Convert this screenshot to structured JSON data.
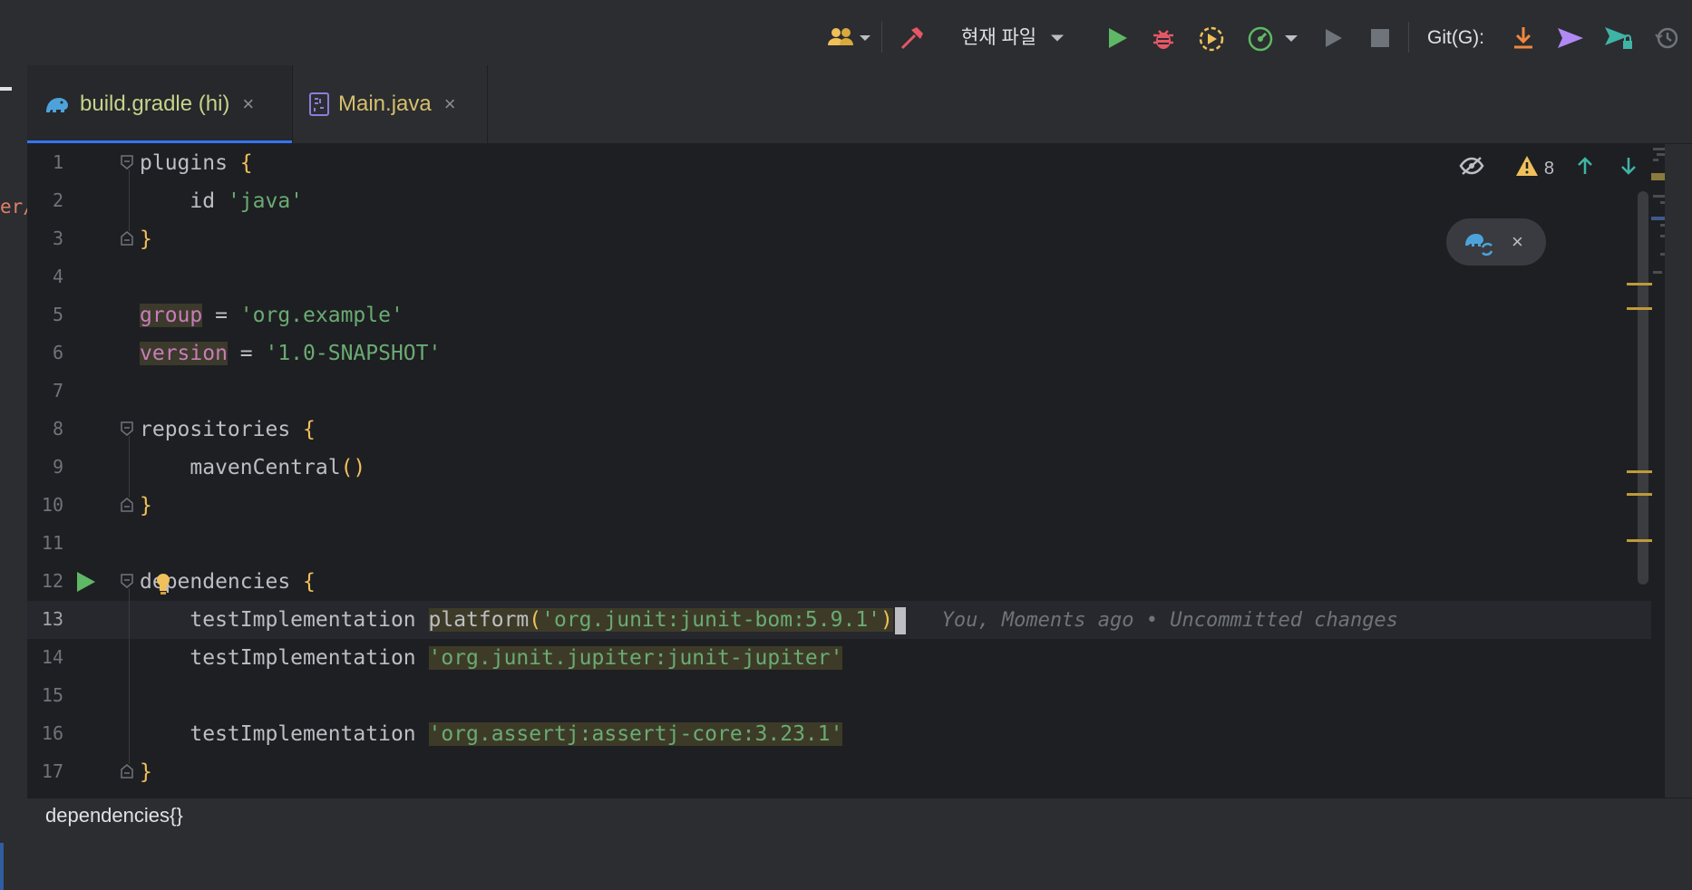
{
  "toolbar": {
    "config_label": "현재 파일",
    "git_label": "Git(G):"
  },
  "left_strip": {
    "fragment": "er/"
  },
  "tabs": [
    {
      "label": "build.gradle (hi)",
      "close": "×",
      "active": true
    },
    {
      "label": "Main.java",
      "close": "×",
      "active": false
    }
  ],
  "editor": {
    "line_numbers": [
      "1",
      "2",
      "3",
      "4",
      "5",
      "6",
      "7",
      "8",
      "9",
      "10",
      "11",
      "12",
      "13",
      "14",
      "15",
      "16",
      "17"
    ],
    "current_line": 13,
    "inspection_warning_count": "8",
    "gradle_popup_close": "×",
    "lines": {
      "l1_kw": "plugins ",
      "l1_brace": "{",
      "l2_indent": "    id ",
      "l2_str": "'java'",
      "l3_brace": "}",
      "l5_prop": "group",
      "l5_eq": " = ",
      "l5_str": "'org.example'",
      "l6_prop": "version",
      "l6_eq": " = ",
      "l6_str": "'1.0-SNAPSHOT'",
      "l8_kw": "repositories ",
      "l8_brace": "{",
      "l9_call": "    mavenCentral",
      "l9_paren": "()",
      "l10_brace": "}",
      "l12_kw": "dependencies ",
      "l12_brace": "{",
      "l13_kw": "    testImplementation ",
      "l13_call": "platform",
      "l13_paren_open": "(",
      "l13_str": "'org.junit:junit-bom:5.9.1'",
      "l13_paren_close": ")",
      "l13_blame": "   You, Moments ago • Uncommitted changes",
      "l14_kw": "    testImplementation ",
      "l14_str": "'org.junit.jupiter:junit-jupiter'",
      "l16_kw": "    testImplementation ",
      "l16_str": "'org.assertj:assertj-core:3.23.1'",
      "l17_brace": "}"
    }
  },
  "breadcrumb": "dependencies{}",
  "colors": {
    "accent": "#3574f0",
    "run_green": "#5fb865",
    "debug_red": "#e55765",
    "warning_yellow": "#f0c05a",
    "string_green": "#6aab73",
    "property_purple": "#c77dbb"
  },
  "icons": {
    "toolbar": [
      "users-icon",
      "chevron-down-icon",
      "hammer-icon",
      "chevron-down-icon",
      "run-icon",
      "debug-icon",
      "coverage-icon",
      "profiler-icon",
      "chevron-down-icon",
      "run-disabled-icon",
      "stop-icon",
      "git-update-icon",
      "git-commit-icon",
      "git-push-icon",
      "history-icon"
    ],
    "tabs": [
      "gradle-elephant-icon",
      "java-class-icon"
    ],
    "editor": [
      "eye-crossed-icon",
      "warning-icon",
      "arrow-up-icon",
      "arrow-down-icon",
      "gradle-sync-icon",
      "run-gutter-icon",
      "lightbulb-icon"
    ]
  }
}
